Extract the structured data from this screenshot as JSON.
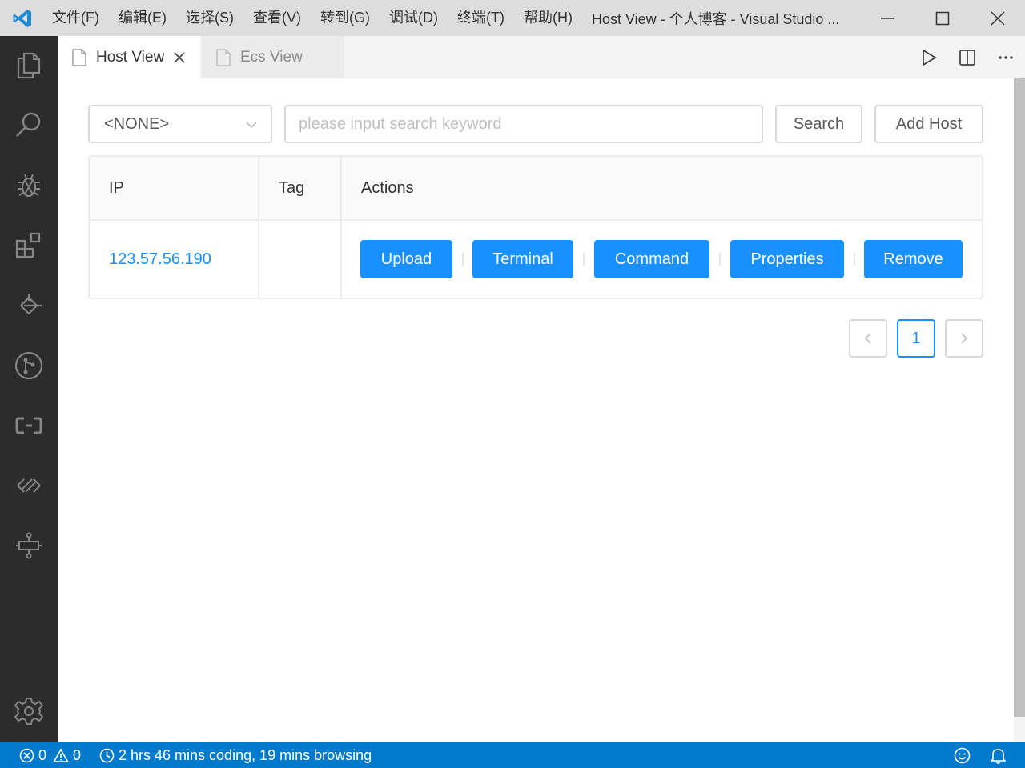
{
  "titlebar": {
    "menu": [
      "文件(F)",
      "编辑(E)",
      "选择(S)",
      "查看(V)",
      "转到(G)",
      "调试(D)",
      "终端(T)",
      "帮助(H)"
    ],
    "window_title": "Host View - 个人博客 - Visual Studio ..."
  },
  "tabs": [
    {
      "label": "Host View",
      "active": true
    },
    {
      "label": "Ecs View",
      "active": false
    }
  ],
  "toolbar": {
    "select_value": "<NONE>",
    "search_placeholder": "please input search keyword",
    "search_label": "Search",
    "add_host_label": "Add Host"
  },
  "table": {
    "headers": [
      "IP",
      "Tag",
      "Actions"
    ],
    "rows": [
      {
        "ip": "123.57.56.190",
        "tag": ""
      }
    ],
    "actions": [
      "Upload",
      "Terminal",
      "Command",
      "Properties",
      "Remove"
    ]
  },
  "pagination": {
    "current_page": "1",
    "prev_icon": "chevron-left-icon",
    "next_icon": "chevron-right-icon"
  },
  "statusbar": {
    "errors": "0",
    "warnings": "0",
    "time_tracking": "2 hrs 46 mins coding, 19 mins browsing"
  },
  "colors": {
    "accent": "#1890ff",
    "statusbar": "#007acc",
    "activitybar": "#2c2c2c",
    "titlebar": "#dddddd"
  }
}
